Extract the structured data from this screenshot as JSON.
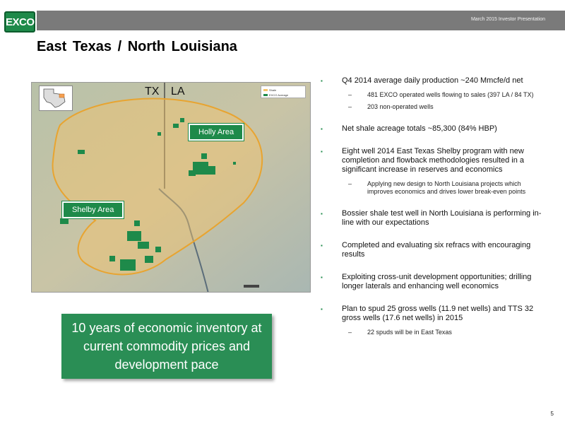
{
  "header": {
    "logo_text": "EXCO",
    "presentation": "March 2015 Investor Presentation"
  },
  "title": "East Texas /  North Louisiana",
  "map": {
    "state_left": "TX",
    "state_right": "LA",
    "holly_label": "Holly Area",
    "shelby_label": "Shelby Area",
    "legend": [
      "Shale",
      "EXCO Acreage"
    ],
    "colors": {
      "shale": "#f5c46a",
      "acreage": "#1e8a4a"
    }
  },
  "callout": "10 years of economic inventory at current commodity prices and development pace",
  "bullets": [
    {
      "text": "Q4 2014 average daily production ~240 Mmcfe/d net",
      "subs": [
        "481 EXCO operated wells flowing to sales (397 LA / 84 TX)",
        "203 non-operated wells"
      ]
    },
    {
      "text": "Net shale acreage totals ~85,300 (84% HBP)",
      "subs": []
    },
    {
      "text": "Eight well 2014 East Texas Shelby program with new completion and flowback methodologies resulted in a significant increase in reserves and economics",
      "subs": [
        "Applying new design to North Louisiana projects which improves economics and drives lower break-even points"
      ]
    },
    {
      "text": "Bossier shale test well in North Louisiana is performing in-line with our expectations",
      "subs": []
    },
    {
      "text": "Completed and evaluating six refracs with encouraging results",
      "subs": []
    },
    {
      "text": "Exploiting cross-unit development opportunities; drilling longer laterals and enhancing well economics",
      "subs": []
    },
    {
      "text": "Plan to spud 25 gross wells (11.9 net wells) and TTS 32 gross wells (17.6 net wells) in 2015",
      "subs": [
        "22 spuds will be in East Texas"
      ]
    }
  ],
  "bullet_mark": "▪",
  "sub_mark": "–",
  "page_number": "5"
}
